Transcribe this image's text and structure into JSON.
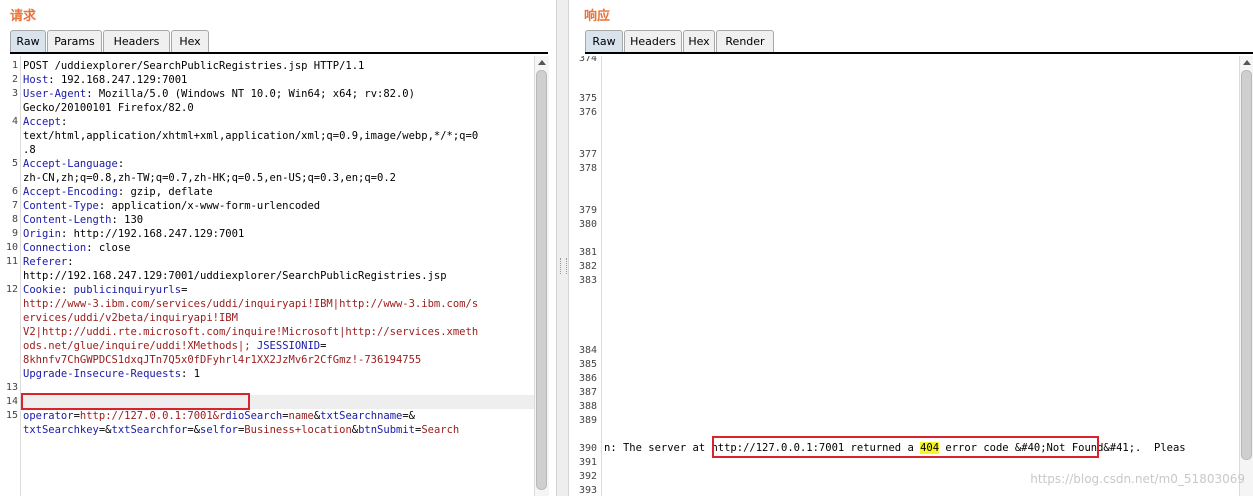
{
  "request": {
    "title": "请求",
    "tabs": [
      "Raw",
      "Params",
      "Headers",
      "Hex"
    ],
    "line_numbers": [
      "1",
      "2",
      "3",
      "",
      "4",
      "",
      "",
      "5",
      "",
      "6",
      "7",
      "8",
      "9",
      "10",
      "11",
      "",
      "12",
      "",
      "",
      "",
      "",
      "",
      "",
      "13",
      "14",
      "15",
      ""
    ],
    "lines": [
      [
        {
          "t": "POST /uddiexplorer/SearchPublicRegistries.jsp HTTP/1.1"
        }
      ],
      [
        {
          "t": "Host",
          "c": "k"
        },
        {
          "t": ": 192.168.247.129:7001"
        }
      ],
      [
        {
          "t": "User-Agent",
          "c": "k"
        },
        {
          "t": ": Mozilla/5.0 (Windows NT 10.0; Win64; x64; rv:82.0)"
        }
      ],
      [
        {
          "t": "Gecko/20100101 Firefox/82.0"
        }
      ],
      [
        {
          "t": "Accept",
          "c": "k"
        },
        {
          "t": ":"
        }
      ],
      [
        {
          "t": "text/html,application/xhtml+xml,application/xml;q=0.9,image/webp,*/*;q=0"
        }
      ],
      [
        {
          "t": ".8"
        }
      ],
      [
        {
          "t": "Accept-Language",
          "c": "k"
        },
        {
          "t": ":"
        }
      ],
      [
        {
          "t": "zh-CN,zh;q=0.8,zh-TW;q=0.7,zh-HK;q=0.5,en-US;q=0.3,en;q=0.2"
        }
      ],
      [
        {
          "t": "Accept-Encoding",
          "c": "k"
        },
        {
          "t": ": gzip, deflate"
        }
      ],
      [
        {
          "t": "Content-Type",
          "c": "k"
        },
        {
          "t": ": application/x-www-form-urlencoded"
        }
      ],
      [
        {
          "t": "Content-Length",
          "c": "k"
        },
        {
          "t": ": 130"
        }
      ],
      [
        {
          "t": "Origin",
          "c": "k"
        },
        {
          "t": ": http://192.168.247.129:7001"
        }
      ],
      [
        {
          "t": "Connection",
          "c": "k"
        },
        {
          "t": ": close"
        }
      ],
      [
        {
          "t": "Referer",
          "c": "k"
        },
        {
          "t": ":"
        }
      ],
      [
        {
          "t": "http://192.168.247.129:7001/uddiexplorer/SearchPublicRegistries.jsp"
        }
      ],
      [
        {
          "t": "Cookie",
          "c": "k"
        },
        {
          "t": ": "
        },
        {
          "t": "publicinquiryurls",
          "c": "k"
        },
        {
          "t": "="
        }
      ],
      [
        {
          "t": "http://www-3.ibm.com/services/uddi/inquiryapi!IBM|http://www-3.ibm.com/s",
          "c": "v"
        }
      ],
      [
        {
          "t": "ervices/uddi/v2beta/inquiryapi!IBM",
          "c": "v"
        }
      ],
      [
        {
          "t": "V2|http://uddi.rte.microsoft.com/inquire!Microsoft|http://services.xmeth",
          "c": "v"
        }
      ],
      [
        {
          "t": "ods.net/glue/inquire/uddi!XMethods|; ",
          "c": "v"
        },
        {
          "t": "JSESSIONID",
          "c": "k"
        },
        {
          "t": "="
        }
      ],
      [
        {
          "t": "8khnfv7ChGWPDCS1dxqJTn7Q5x0fDFyhrl4r1XX2JzMv6r2CfGmz!-736194755",
          "c": "v"
        }
      ],
      [
        {
          "t": "Upgrade-Insecure-Requests",
          "c": "k"
        },
        {
          "t": ": 1"
        }
      ],
      [
        {
          "t": ""
        }
      ],
      [
        {
          "t": ""
        }
      ],
      [
        {
          "t": "operator",
          "c": "k"
        },
        {
          "t": "="
        },
        {
          "t": "http://127.0.0.1:7001&r",
          "c": "v"
        },
        {
          "t": "dioSearch",
          "c": "k"
        },
        {
          "t": "="
        },
        {
          "t": "name",
          "c": "v"
        },
        {
          "t": "&"
        },
        {
          "t": "txtSearchname",
          "c": "k"
        },
        {
          "t": "=&"
        }
      ],
      [
        {
          "t": "txtSearchkey",
          "c": "k"
        },
        {
          "t": "=&"
        },
        {
          "t": "txtSearchfor",
          "c": "k"
        },
        {
          "t": "=&"
        },
        {
          "t": "selfor",
          "c": "k"
        },
        {
          "t": "="
        },
        {
          "t": "Business+location",
          "c": "v"
        },
        {
          "t": "&"
        },
        {
          "t": "btnSubmit",
          "c": "k"
        },
        {
          "t": "="
        },
        {
          "t": "Search",
          "c": "v"
        }
      ]
    ]
  },
  "response": {
    "title": "响应",
    "tabs": [
      "Raw",
      "Headers",
      "Hex",
      "Render"
    ],
    "line_numbers": [
      "374",
      "375",
      "376",
      "377",
      "378",
      "379",
      "380",
      "381",
      "382",
      "383",
      "384",
      "385",
      "386",
      "387",
      "388",
      "389",
      "390",
      "391",
      "392",
      "393"
    ],
    "line390": {
      "prefix": "n: The server at ",
      "url": "http://127.0.0.1:7001",
      "mid": " returned a ",
      "code": "404",
      "suffix": " error code &#40;Not Found&#41;.  Pleas"
    }
  },
  "watermark": "https://blog.csdn.net/m0_51803069"
}
